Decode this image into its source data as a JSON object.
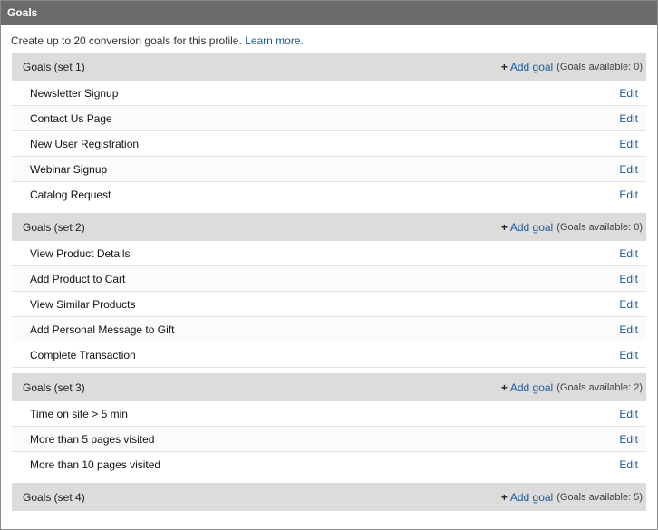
{
  "panel": {
    "title": "Goals",
    "intro_text": "Create up to 20 conversion goals for this profile.",
    "learn_more": "Learn more."
  },
  "sets": [
    {
      "title": "Goals (set 1)",
      "add_symbol": "+",
      "add_label": "Add goal",
      "available": "(Goals available: 0)",
      "goals": [
        {
          "name": "Newsletter Signup",
          "edit": "Edit"
        },
        {
          "name": "Contact Us Page",
          "edit": "Edit"
        },
        {
          "name": "New User Registration",
          "edit": "Edit"
        },
        {
          "name": "Webinar Signup",
          "edit": "Edit"
        },
        {
          "name": "Catalog Request",
          "edit": "Edit"
        }
      ]
    },
    {
      "title": "Goals (set 2)",
      "add_symbol": "+",
      "add_label": "Add goal",
      "available": "(Goals available: 0)",
      "goals": [
        {
          "name": "View Product Details",
          "edit": "Edit"
        },
        {
          "name": "Add Product to Cart",
          "edit": "Edit"
        },
        {
          "name": "View Similar Products",
          "edit": "Edit"
        },
        {
          "name": "Add Personal Message to Gift",
          "edit": "Edit"
        },
        {
          "name": "Complete Transaction",
          "edit": "Edit"
        }
      ]
    },
    {
      "title": "Goals (set 3)",
      "add_symbol": "+",
      "add_label": "Add goal",
      "available": "(Goals available: 2)",
      "goals": [
        {
          "name": "Time on site > 5 min",
          "edit": "Edit"
        },
        {
          "name": "More than 5 pages visited",
          "edit": "Edit"
        },
        {
          "name": "More than 10 pages visited",
          "edit": "Edit"
        }
      ]
    },
    {
      "title": "Goals (set 4)",
      "add_symbol": "+",
      "add_label": "Add goal",
      "available": "(Goals available: 5)",
      "goals": []
    }
  ]
}
